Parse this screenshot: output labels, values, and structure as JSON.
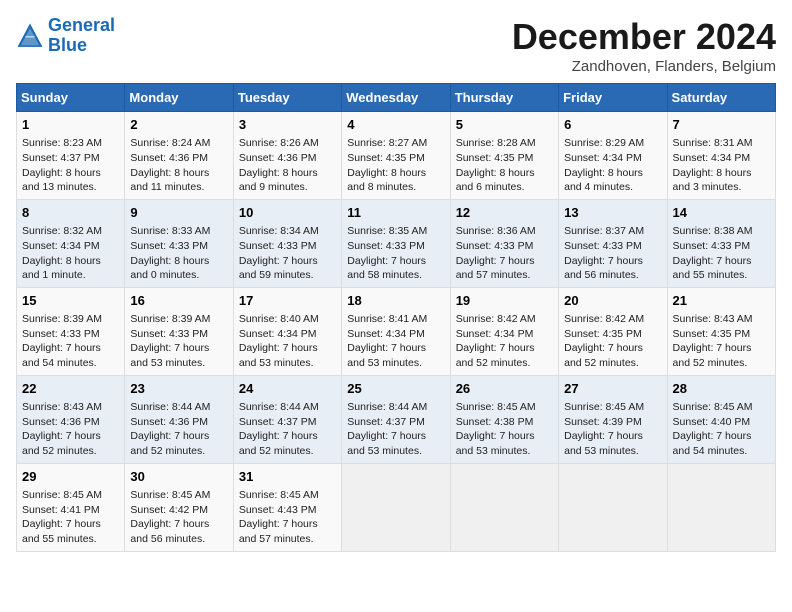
{
  "header": {
    "logo_line1": "General",
    "logo_line2": "Blue",
    "month": "December 2024",
    "location": "Zandhoven, Flanders, Belgium"
  },
  "days_of_week": [
    "Sunday",
    "Monday",
    "Tuesday",
    "Wednesday",
    "Thursday",
    "Friday",
    "Saturday"
  ],
  "weeks": [
    [
      {
        "day": "1",
        "info": "Sunrise: 8:23 AM\nSunset: 4:37 PM\nDaylight: 8 hours\nand 13 minutes."
      },
      {
        "day": "2",
        "info": "Sunrise: 8:24 AM\nSunset: 4:36 PM\nDaylight: 8 hours\nand 11 minutes."
      },
      {
        "day": "3",
        "info": "Sunrise: 8:26 AM\nSunset: 4:36 PM\nDaylight: 8 hours\nand 9 minutes."
      },
      {
        "day": "4",
        "info": "Sunrise: 8:27 AM\nSunset: 4:35 PM\nDaylight: 8 hours\nand 8 minutes."
      },
      {
        "day": "5",
        "info": "Sunrise: 8:28 AM\nSunset: 4:35 PM\nDaylight: 8 hours\nand 6 minutes."
      },
      {
        "day": "6",
        "info": "Sunrise: 8:29 AM\nSunset: 4:34 PM\nDaylight: 8 hours\nand 4 minutes."
      },
      {
        "day": "7",
        "info": "Sunrise: 8:31 AM\nSunset: 4:34 PM\nDaylight: 8 hours\nand 3 minutes."
      }
    ],
    [
      {
        "day": "8",
        "info": "Sunrise: 8:32 AM\nSunset: 4:34 PM\nDaylight: 8 hours\nand 1 minute."
      },
      {
        "day": "9",
        "info": "Sunrise: 8:33 AM\nSunset: 4:33 PM\nDaylight: 8 hours\nand 0 minutes."
      },
      {
        "day": "10",
        "info": "Sunrise: 8:34 AM\nSunset: 4:33 PM\nDaylight: 7 hours\nand 59 minutes."
      },
      {
        "day": "11",
        "info": "Sunrise: 8:35 AM\nSunset: 4:33 PM\nDaylight: 7 hours\nand 58 minutes."
      },
      {
        "day": "12",
        "info": "Sunrise: 8:36 AM\nSunset: 4:33 PM\nDaylight: 7 hours\nand 57 minutes."
      },
      {
        "day": "13",
        "info": "Sunrise: 8:37 AM\nSunset: 4:33 PM\nDaylight: 7 hours\nand 56 minutes."
      },
      {
        "day": "14",
        "info": "Sunrise: 8:38 AM\nSunset: 4:33 PM\nDaylight: 7 hours\nand 55 minutes."
      }
    ],
    [
      {
        "day": "15",
        "info": "Sunrise: 8:39 AM\nSunset: 4:33 PM\nDaylight: 7 hours\nand 54 minutes."
      },
      {
        "day": "16",
        "info": "Sunrise: 8:39 AM\nSunset: 4:33 PM\nDaylight: 7 hours\nand 53 minutes."
      },
      {
        "day": "17",
        "info": "Sunrise: 8:40 AM\nSunset: 4:34 PM\nDaylight: 7 hours\nand 53 minutes."
      },
      {
        "day": "18",
        "info": "Sunrise: 8:41 AM\nSunset: 4:34 PM\nDaylight: 7 hours\nand 53 minutes."
      },
      {
        "day": "19",
        "info": "Sunrise: 8:42 AM\nSunset: 4:34 PM\nDaylight: 7 hours\nand 52 minutes."
      },
      {
        "day": "20",
        "info": "Sunrise: 8:42 AM\nSunset: 4:35 PM\nDaylight: 7 hours\nand 52 minutes."
      },
      {
        "day": "21",
        "info": "Sunrise: 8:43 AM\nSunset: 4:35 PM\nDaylight: 7 hours\nand 52 minutes."
      }
    ],
    [
      {
        "day": "22",
        "info": "Sunrise: 8:43 AM\nSunset: 4:36 PM\nDaylight: 7 hours\nand 52 minutes."
      },
      {
        "day": "23",
        "info": "Sunrise: 8:44 AM\nSunset: 4:36 PM\nDaylight: 7 hours\nand 52 minutes."
      },
      {
        "day": "24",
        "info": "Sunrise: 8:44 AM\nSunset: 4:37 PM\nDaylight: 7 hours\nand 52 minutes."
      },
      {
        "day": "25",
        "info": "Sunrise: 8:44 AM\nSunset: 4:37 PM\nDaylight: 7 hours\nand 53 minutes."
      },
      {
        "day": "26",
        "info": "Sunrise: 8:45 AM\nSunset: 4:38 PM\nDaylight: 7 hours\nand 53 minutes."
      },
      {
        "day": "27",
        "info": "Sunrise: 8:45 AM\nSunset: 4:39 PM\nDaylight: 7 hours\nand 53 minutes."
      },
      {
        "day": "28",
        "info": "Sunrise: 8:45 AM\nSunset: 4:40 PM\nDaylight: 7 hours\nand 54 minutes."
      }
    ],
    [
      {
        "day": "29",
        "info": "Sunrise: 8:45 AM\nSunset: 4:41 PM\nDaylight: 7 hours\nand 55 minutes."
      },
      {
        "day": "30",
        "info": "Sunrise: 8:45 AM\nSunset: 4:42 PM\nDaylight: 7 hours\nand 56 minutes."
      },
      {
        "day": "31",
        "info": "Sunrise: 8:45 AM\nSunset: 4:43 PM\nDaylight: 7 hours\nand 57 minutes."
      },
      {
        "day": "",
        "info": ""
      },
      {
        "day": "",
        "info": ""
      },
      {
        "day": "",
        "info": ""
      },
      {
        "day": "",
        "info": ""
      }
    ]
  ]
}
